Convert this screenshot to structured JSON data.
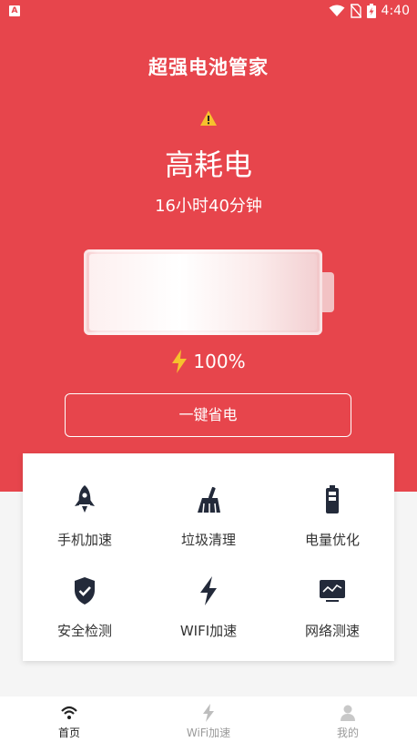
{
  "status_bar": {
    "app_badge": "A",
    "time": "4:40"
  },
  "header": {
    "title": "超强电池管家"
  },
  "battery": {
    "status": "高耗电",
    "time_remaining": "16小时40分钟",
    "charge_percent": "100%",
    "level": 1.0
  },
  "save_button": {
    "label": "一键省电"
  },
  "tools": [
    {
      "label": "手机加速",
      "icon": "rocket-icon"
    },
    {
      "label": "垃圾清理",
      "icon": "broom-icon"
    },
    {
      "label": "电量优化",
      "icon": "battery-icon"
    },
    {
      "label": "安全检测",
      "icon": "shield-check-icon"
    },
    {
      "label": "WIFI加速",
      "icon": "lightning-icon"
    },
    {
      "label": "网络测速",
      "icon": "monitor-chart-icon"
    }
  ],
  "bottom_nav": [
    {
      "label": "首页",
      "icon": "wifi-icon",
      "active": true
    },
    {
      "label": "WiFi加速",
      "icon": "lightning-icon",
      "active": false
    },
    {
      "label": "我的",
      "icon": "user-icon",
      "active": false
    }
  ],
  "colors": {
    "primary": "#e7454c",
    "icon_dark": "#232a3a",
    "inactive": "#b5b5b5"
  }
}
